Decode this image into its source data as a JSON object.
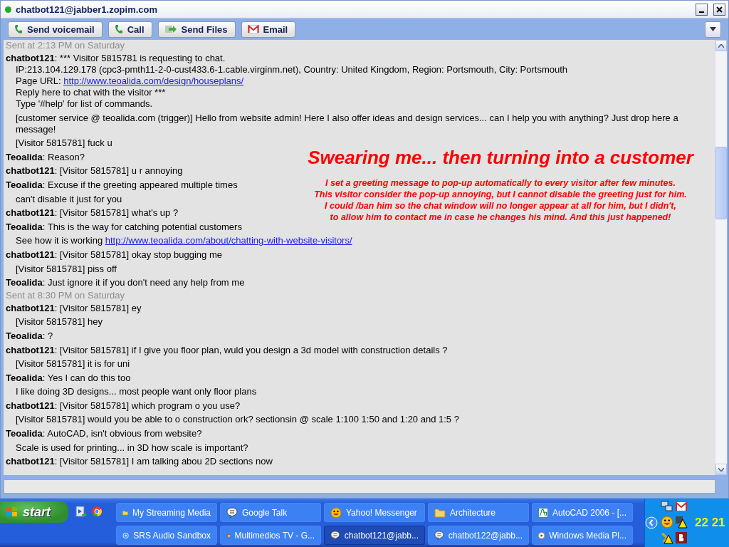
{
  "window": {
    "title": "chatbot121@jabber1.zopim.com"
  },
  "toolbar": [
    {
      "label": "Send voicemail",
      "kind": "phone"
    },
    {
      "label": "Call",
      "kind": "phone"
    },
    {
      "label": "Send Files",
      "kind": "files"
    },
    {
      "label": "Email",
      "kind": "mail"
    }
  ],
  "messages": [
    {
      "kind": "timestamp",
      "text": "Sent at 2:13 PM on Saturday"
    },
    {
      "kind": "message",
      "sender": "chatbot121",
      "lines": [
        {
          "text": ": *** Visitor 5815781 is requesting to chat."
        },
        {
          "text": "IP:213.104.129.178 (cpc3-pmth11-2-0-cust433.6-1.cable.virginm.net), Country: United Kingdom, Region: Portsmouth, City: Portsmouth"
        },
        {
          "text": "Page URL: ",
          "link": "http://www.teoalida.com/design/houseplans/"
        },
        {
          "text": "Reply here to chat with the visitor ***"
        },
        {
          "text": "Type '#help' for list of commands."
        }
      ]
    },
    {
      "kind": "message",
      "lines": [
        {
          "text": "[customer service @ teoalida.com (trigger)] Hello from website admin! Here I also offer ideas and design services... can I help you with anything? Just drop here a message!"
        }
      ]
    },
    {
      "kind": "message",
      "lines": [
        {
          "text": "[Visitor 5815781] fuck u"
        }
      ]
    },
    {
      "kind": "message",
      "sender": "Teoalida",
      "lines": [
        {
          "text": ": Reason?"
        }
      ]
    },
    {
      "kind": "message",
      "sender": "chatbot121",
      "lines": [
        {
          "text": ": [Visitor 5815781] u r annoying"
        }
      ]
    },
    {
      "kind": "message",
      "sender": "Teoalida",
      "lines": [
        {
          "text": ": Excuse if the greeting appeared multiple times"
        }
      ]
    },
    {
      "kind": "message",
      "lines": [
        {
          "text": "can't disable it just for you"
        }
      ]
    },
    {
      "kind": "message",
      "sender": "chatbot121",
      "lines": [
        {
          "text": ": [Visitor 5815781] what's up ?"
        }
      ]
    },
    {
      "kind": "message",
      "sender": "Teoalida",
      "lines": [
        {
          "text": ": This is the way for catching potential customers"
        }
      ]
    },
    {
      "kind": "message",
      "lines": [
        {
          "text": "See how it is working ",
          "link": "http://www.teoalida.com/about/chatting-with-website-visitors/"
        }
      ]
    },
    {
      "kind": "message",
      "sender": "chatbot121",
      "lines": [
        {
          "text": ": [Visitor 5815781] okay stop bugging me"
        }
      ]
    },
    {
      "kind": "message",
      "lines": [
        {
          "text": "[Visitor 5815781] piss off"
        }
      ]
    },
    {
      "kind": "message",
      "sender": "Teoalida",
      "lines": [
        {
          "text": ": Just ignore it if you don't need any help from me"
        }
      ]
    },
    {
      "kind": "timestamp",
      "text": "Sent at 8:30 PM on Saturday"
    },
    {
      "kind": "message",
      "sender": "chatbot121",
      "lines": [
        {
          "text": ": [Visitor 5815781] ey"
        }
      ]
    },
    {
      "kind": "message",
      "lines": [
        {
          "text": "[Visitor 5815781] hey"
        }
      ]
    },
    {
      "kind": "message",
      "sender": "Teoalida",
      "lines": [
        {
          "text": ": ?"
        }
      ]
    },
    {
      "kind": "message",
      "sender": "chatbot121",
      "lines": [
        {
          "text": ": [Visitor 5815781] if I give you floor plan, wuld you design a 3d model with construction details ?"
        }
      ]
    },
    {
      "kind": "message",
      "lines": [
        {
          "text": "[Visitor 5815781] it is for uni"
        }
      ]
    },
    {
      "kind": "message",
      "sender": "Teoalida",
      "lines": [
        {
          "text": ": Yes I can do this too"
        }
      ]
    },
    {
      "kind": "message",
      "lines": [
        {
          "text": "I like doing 3D designs... most people want only floor plans"
        }
      ]
    },
    {
      "kind": "message",
      "sender": "chatbot121",
      "lines": [
        {
          "text": ": [Visitor 5815781] which program o you use?"
        }
      ]
    },
    {
      "kind": "message",
      "lines": [
        {
          "text": "[Visitor 5815781] would you be able to o construction ork? sectionsin @ scale 1:100 1:50 and 1:20 and 1:5 ?"
        }
      ]
    },
    {
      "kind": "message",
      "sender": "Teoalida",
      "lines": [
        {
          "text": ": AutoCAD, isn't obvious from website?"
        }
      ]
    },
    {
      "kind": "message",
      "lines": [
        {
          "text": "Scale is used for printing... in 3D how scale is important?"
        }
      ]
    },
    {
      "kind": "message",
      "sender": "chatbot121",
      "lines": [
        {
          "text": ": [Visitor 5815781] I am talking abou 2D sections now"
        }
      ]
    }
  ],
  "annotation": {
    "title": "Swearing me... then turning into a customer",
    "lines": [
      "I set a greeting message to pop-up automatically to every visitor after few minutes.",
      "This visitor consider the pop-up annoying, but I cannot disable the greeting just for him.",
      "I could /ban him so the chat window will no longer appear at all for him, but I didn't,",
      "to allow him to contact me in case he changes his mind. And this just happened!"
    ]
  },
  "taskbar": {
    "start": "start",
    "tasks": [
      {
        "label": "My Streaming Media",
        "kind": "folder",
        "selected": false
      },
      {
        "label": "Google Talk",
        "kind": "bubble",
        "selected": false
      },
      {
        "label": "Yahoo! Messenger",
        "kind": "smiley",
        "selected": false
      },
      {
        "label": "Architecture",
        "kind": "folder",
        "selected": false
      },
      {
        "label": "AutoCAD 2006 - [...",
        "kind": "cad",
        "selected": false
      },
      {
        "label": "SRS Audio Sandbox",
        "kind": "ring",
        "selected": false
      },
      {
        "label": "Multimedios TV - G...",
        "kind": "browser",
        "selected": false
      },
      {
        "label": "chatbot121@jabb...",
        "kind": "bubble",
        "selected": true
      },
      {
        "label": "chatbot122@jabb...",
        "kind": "bubble",
        "selected": false
      },
      {
        "label": "Windows Media Pl...",
        "kind": "player",
        "selected": false
      }
    ],
    "clock": "22 21"
  }
}
